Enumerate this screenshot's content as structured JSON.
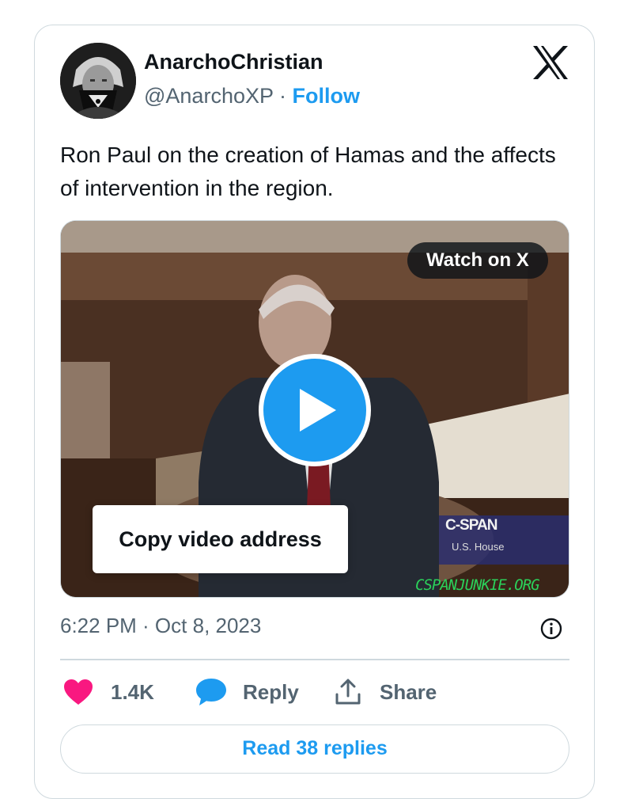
{
  "author": {
    "display_name": "AnarchoChristian",
    "handle": "@AnarchoXP",
    "separator": "·",
    "follow_label": "Follow"
  },
  "tweet": {
    "text": "Ron Paul on the creation of Hamas and the affects of intervention in the region."
  },
  "media": {
    "watch_label": "Watch on X",
    "context_menu_item": "Copy video address",
    "overlay_brand": "C-SPAN",
    "overlay_subtitle": "U.S. House",
    "overlay_watermark": "CSPANJUNKIE.ORG"
  },
  "meta": {
    "timestamp": "6:22 PM · Oct 8, 2023"
  },
  "actions": {
    "likes_count": "1.4K",
    "reply_label": "Reply",
    "share_label": "Share",
    "read_replies_label": "Read 38 replies"
  },
  "colors": {
    "accent": "#1d9bf0",
    "like": "#f91880",
    "text_secondary": "#536471",
    "border": "#cfd9de"
  }
}
